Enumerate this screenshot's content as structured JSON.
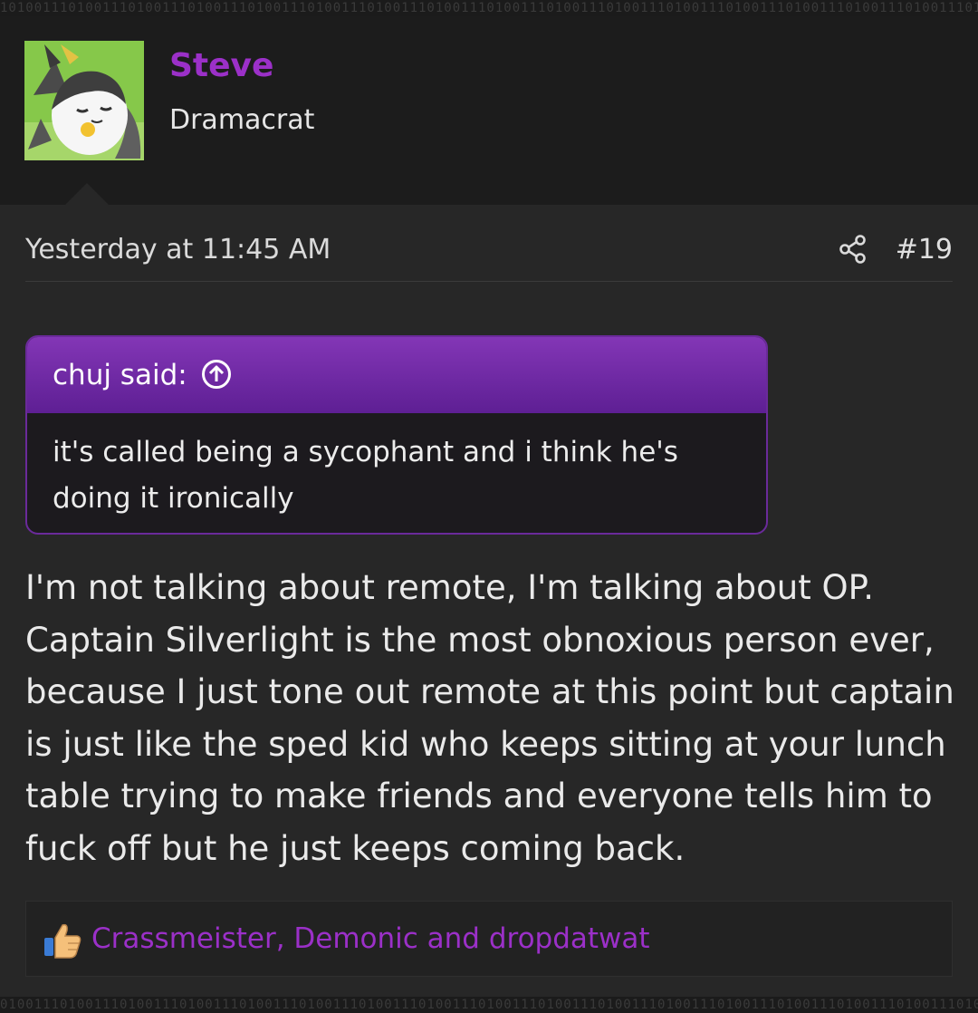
{
  "user": {
    "name": "Steve",
    "title": "Dramacrat"
  },
  "post": {
    "date": "Yesterday at 11:45 AM",
    "number": "#19",
    "share_icon": "share-icon",
    "quote": {
      "author": "chuj said:",
      "arrow_icon": "arrow-up-circle-icon",
      "text": "it's called being a sycophant and i think he's doing it ironically"
    },
    "body": "I'm not talking about remote, I'm talking about OP. Captain Silverlight is the most obnoxious person ever, because I just tone out remote at this point but captain is just like the sped kid who keeps sitting at your lunch table trying to make friends and everyone tells him to fuck off but he just keeps coming back.",
    "reactions": {
      "icon": "thumbs-up-icon",
      "users": "Crassmeister, Demonic and dropdatwat"
    }
  },
  "colors": {
    "username": "#9b30c8",
    "quote_header": "#7a2fb0",
    "reaction_link": "#9b30c8",
    "post_background": "#272727"
  }
}
